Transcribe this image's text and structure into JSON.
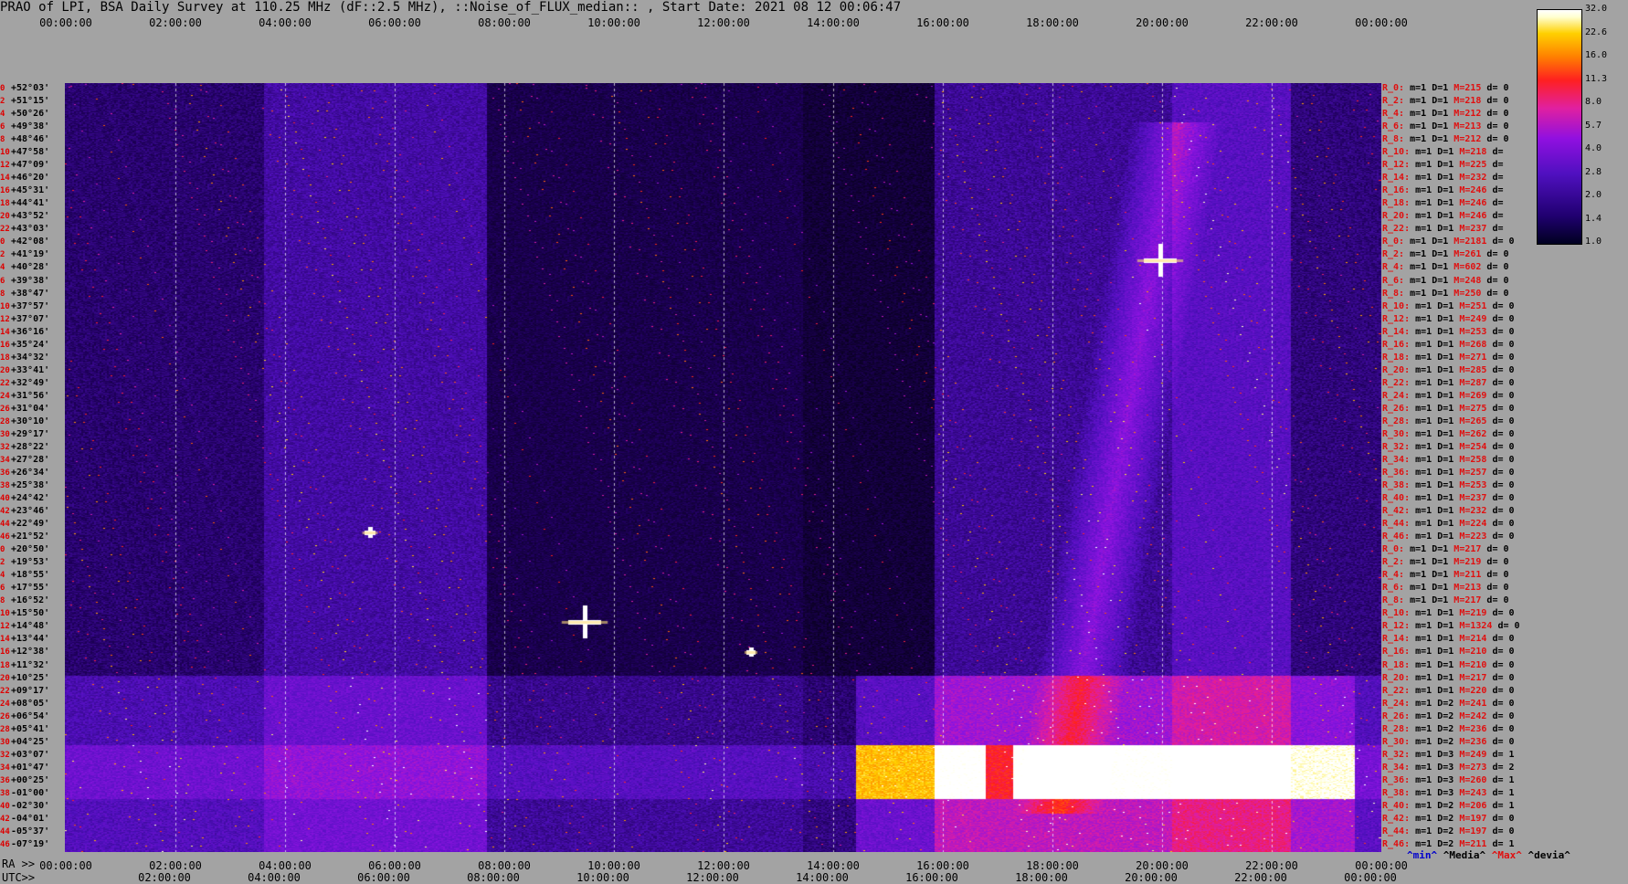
{
  "title": "PRAO of LPI, BSA Daily Survey at 110.25 MHz (dF::2.5 MHz), ::Noise_of_FLUX_median:: , Start Date: 2021 08 12 00:06:47",
  "time_ticks": [
    "00:00:00",
    "02:00:00",
    "04:00:00",
    "06:00:00",
    "08:00:00",
    "10:00:00",
    "12:00:00",
    "14:00:00",
    "16:00:00",
    "18:00:00",
    "20:00:00",
    "22:00:00",
    "00:00:00"
  ],
  "bottom_ra_label": "RA >>",
  "bottom_utc_label": "UTC>>",
  "bottom_ticks_row1": [
    "00:00:00",
    "02:00:00",
    "04:00:00",
    "06:00:00",
    "08:00:00",
    "10:00:00",
    "12:00:00",
    "14:00:00",
    "16:00:00",
    "18:00:00",
    "20:00:00",
    "22:00:00",
    "00:00:00"
  ],
  "bottom_ticks_row2": [
    "02:00:00",
    "04:00:00",
    "06:00:00",
    "08:00:00",
    "10:00:00",
    "12:00:00",
    "14:00:00",
    "16:00:00",
    "18:00:00",
    "20:00:00",
    "22:00:00",
    "00:00:00"
  ],
  "colorbar_ticks": [
    "32.0",
    "22.6",
    "16.0",
    "11.3",
    "8.0",
    "5.7",
    "4.0",
    "2.8",
    "2.0",
    "1.4",
    "1.0"
  ],
  "legend": {
    "min": "^min^",
    "median": "^Media^",
    "max": "^Max^",
    "devia": "^devia^"
  },
  "colors": {
    "background": "#a3a3a3",
    "plot_dark": "#08001a",
    "label_red": "#e01010",
    "min_blue": "#0000cc"
  },
  "chart_data": {
    "type": "heatmap",
    "title": "PRAO of LPI, BSA Daily Survey at 110.25 MHz (dF::2.5 MHz), ::Noise_of_FLUX_median:: , Start Date: 2021 08 12 00:06:47",
    "x_axis": "time 00:00:00 to 00:00:00 (24h)",
    "y_axis_declinations": [
      "+52°03'",
      "+51°15'",
      "+50°26'",
      "+49°38'",
      "+48°46'",
      "+47°58'",
      "+47°09'",
      "+46°20'",
      "+45°31'",
      "+44°41'",
      "+43°52'",
      "+43°03'",
      "+42°08'",
      "+41°19'",
      "+40°28'",
      "+39°38'",
      "+38°47'",
      "+37°57'",
      "+37°07'",
      "+36°16'",
      "+35°24'",
      "+34°32'",
      "+33°41'",
      "+32°49'",
      "+31°56'",
      "+31°04'",
      "+30°10'",
      "+29°17'",
      "+28°22'",
      "+27°28'",
      "+26°34'",
      "+25°38'",
      "+24°42'",
      "+23°46'",
      "+22°49'",
      "+21°52'",
      "+20°50'",
      "+19°53'",
      "+18°55'",
      "+17°55'",
      "+16°52'",
      "+15°50'",
      "+14°48'",
      "+13°44'",
      "+12°38'",
      "+11°32'",
      "+10°25'",
      "+09°17'",
      "+08°05'",
      "+06°54'",
      "+05°41'",
      "+04°25'",
      "+03°07'",
      "+01°47'",
      "+00°25'",
      "-01°00'",
      "-02°30'",
      "-04°01'",
      "-05°37'",
      "-07°19'"
    ],
    "y_axis_indices": [
      "0",
      "2",
      "4",
      "6",
      "8",
      "10",
      "12",
      "14",
      "16",
      "18",
      "20",
      "22",
      "0",
      "2",
      "4",
      "6",
      "8",
      "10",
      "12",
      "14",
      "16",
      "18",
      "20",
      "22",
      "24",
      "26",
      "28",
      "30",
      "32",
      "34",
      "36",
      "38",
      "40",
      "42",
      "44",
      "46",
      "0",
      "2",
      "4",
      "6",
      "8",
      "10",
      "12",
      "14",
      "16",
      "18",
      "20",
      "22",
      "24",
      "26",
      "28",
      "30",
      "32",
      "34",
      "36",
      "38",
      "40",
      "42",
      "44",
      "46"
    ],
    "colorbar_range": [
      1.0,
      32.0
    ],
    "colorbar_scale": "log",
    "row_stats": [
      {
        "r": "R_0:",
        "m": "1",
        "D": "1",
        "M": "215",
        "d": "0"
      },
      {
        "r": "R_2:",
        "m": "1",
        "D": "1",
        "M": "218",
        "d": "0"
      },
      {
        "r": "R_4:",
        "m": "1",
        "D": "1",
        "M": "212",
        "d": "0"
      },
      {
        "r": "R_6:",
        "m": "1",
        "D": "1",
        "M": "213",
        "d": "0"
      },
      {
        "r": "R_8:",
        "m": "1",
        "D": "1",
        "M": "212",
        "d": "0"
      },
      {
        "r": "R_10:",
        "m": "1",
        "D": "1",
        "M": "218",
        "d": ""
      },
      {
        "r": "R_12:",
        "m": "1",
        "D": "1",
        "M": "225",
        "d": ""
      },
      {
        "r": "R_14:",
        "m": "1",
        "D": "1",
        "M": "232",
        "d": ""
      },
      {
        "r": "R_16:",
        "m": "1",
        "D": "1",
        "M": "246",
        "d": ""
      },
      {
        "r": "R_18:",
        "m": "1",
        "D": "1",
        "M": "246",
        "d": ""
      },
      {
        "r": "R_20:",
        "m": "1",
        "D": "1",
        "M": "246",
        "d": ""
      },
      {
        "r": "R_22:",
        "m": "1",
        "D": "1",
        "M": "237",
        "d": ""
      },
      {
        "r": "R_0:",
        "m": "1",
        "D": "1",
        "M": "2181",
        "d": "0"
      },
      {
        "r": "R_2:",
        "m": "1",
        "D": "1",
        "M": "261",
        "d": "0"
      },
      {
        "r": "R_4:",
        "m": "1",
        "D": "1",
        "M": "602",
        "d": "0"
      },
      {
        "r": "R_6:",
        "m": "1",
        "D": "1",
        "M": "248",
        "d": "0"
      },
      {
        "r": "R_8:",
        "m": "1",
        "D": "1",
        "M": "250",
        "d": "0"
      },
      {
        "r": "R_10:",
        "m": "1",
        "D": "1",
        "M": "251",
        "d": "0"
      },
      {
        "r": "R_12:",
        "m": "1",
        "D": "1",
        "M": "249",
        "d": "0"
      },
      {
        "r": "R_14:",
        "m": "1",
        "D": "1",
        "M": "253",
        "d": "0"
      },
      {
        "r": "R_16:",
        "m": "1",
        "D": "1",
        "M": "268",
        "d": "0"
      },
      {
        "r": "R_18:",
        "m": "1",
        "D": "1",
        "M": "271",
        "d": "0"
      },
      {
        "r": "R_20:",
        "m": "1",
        "D": "1",
        "M": "285",
        "d": "0"
      },
      {
        "r": "R_22:",
        "m": "1",
        "D": "1",
        "M": "287",
        "d": "0"
      },
      {
        "r": "R_24:",
        "m": "1",
        "D": "1",
        "M": "269",
        "d": "0"
      },
      {
        "r": "R_26:",
        "m": "1",
        "D": "1",
        "M": "275",
        "d": "0"
      },
      {
        "r": "R_28:",
        "m": "1",
        "D": "1",
        "M": "265",
        "d": "0"
      },
      {
        "r": "R_30:",
        "m": "1",
        "D": "1",
        "M": "262",
        "d": "0"
      },
      {
        "r": "R_32:",
        "m": "1",
        "D": "1",
        "M": "254",
        "d": "0"
      },
      {
        "r": "R_34:",
        "m": "1",
        "D": "1",
        "M": "258",
        "d": "0"
      },
      {
        "r": "R_36:",
        "m": "1",
        "D": "1",
        "M": "257",
        "d": "0"
      },
      {
        "r": "R_38:",
        "m": "1",
        "D": "1",
        "M": "253",
        "d": "0"
      },
      {
        "r": "R_40:",
        "m": "1",
        "D": "1",
        "M": "237",
        "d": "0"
      },
      {
        "r": "R_42:",
        "m": "1",
        "D": "1",
        "M": "232",
        "d": "0"
      },
      {
        "r": "R_44:",
        "m": "1",
        "D": "1",
        "M": "224",
        "d": "0"
      },
      {
        "r": "R_46:",
        "m": "1",
        "D": "1",
        "M": "223",
        "d": "0"
      },
      {
        "r": "R_0:",
        "m": "1",
        "D": "1",
        "M": "217",
        "d": "0"
      },
      {
        "r": "R_2:",
        "m": "1",
        "D": "1",
        "M": "219",
        "d": "0"
      },
      {
        "r": "R_4:",
        "m": "1",
        "D": "1",
        "M": "211",
        "d": "0"
      },
      {
        "r": "R_6:",
        "m": "1",
        "D": "1",
        "M": "213",
        "d": "0"
      },
      {
        "r": "R_8:",
        "m": "1",
        "D": "1",
        "M": "217",
        "d": "0"
      },
      {
        "r": "R_10:",
        "m": "1",
        "D": "1",
        "M": "219",
        "d": "0"
      },
      {
        "r": "R_12:",
        "m": "1",
        "D": "1",
        "M": "1324",
        "d": "0"
      },
      {
        "r": "R_14:",
        "m": "1",
        "D": "1",
        "M": "214",
        "d": "0"
      },
      {
        "r": "R_16:",
        "m": "1",
        "D": "1",
        "M": "210",
        "d": "0"
      },
      {
        "r": "R_18:",
        "m": "1",
        "D": "1",
        "M": "210",
        "d": "0"
      },
      {
        "r": "R_20:",
        "m": "1",
        "D": "1",
        "M": "217",
        "d": "0"
      },
      {
        "r": "R_22:",
        "m": "1",
        "D": "1",
        "M": "220",
        "d": "0"
      },
      {
        "r": "R_24:",
        "m": "1",
        "D": "2",
        "M": "241",
        "d": "0"
      },
      {
        "r": "R_26:",
        "m": "1",
        "D": "2",
        "M": "242",
        "d": "0"
      },
      {
        "r": "R_28:",
        "m": "1",
        "D": "2",
        "M": "236",
        "d": "0"
      },
      {
        "r": "R_30:",
        "m": "1",
        "D": "2",
        "M": "236",
        "d": "0"
      },
      {
        "r": "R_32:",
        "m": "1",
        "D": "3",
        "M": "249",
        "d": "1"
      },
      {
        "r": "R_34:",
        "m": "1",
        "D": "3",
        "M": "273",
        "d": "2"
      },
      {
        "r": "R_36:",
        "m": "1",
        "D": "3",
        "M": "260",
        "d": "1"
      },
      {
        "r": "R_38:",
        "m": "1",
        "D": "3",
        "M": "243",
        "d": "1"
      },
      {
        "r": "R_40:",
        "m": "1",
        "D": "2",
        "M": "206",
        "d": "1"
      },
      {
        "r": "R_42:",
        "m": "1",
        "D": "2",
        "M": "197",
        "d": "0"
      },
      {
        "r": "R_44:",
        "m": "1",
        "D": "2",
        "M": "197",
        "d": "0"
      },
      {
        "r": "R_46:",
        "m": "1",
        "D": "2",
        "M": "211",
        "d": "1"
      }
    ]
  }
}
